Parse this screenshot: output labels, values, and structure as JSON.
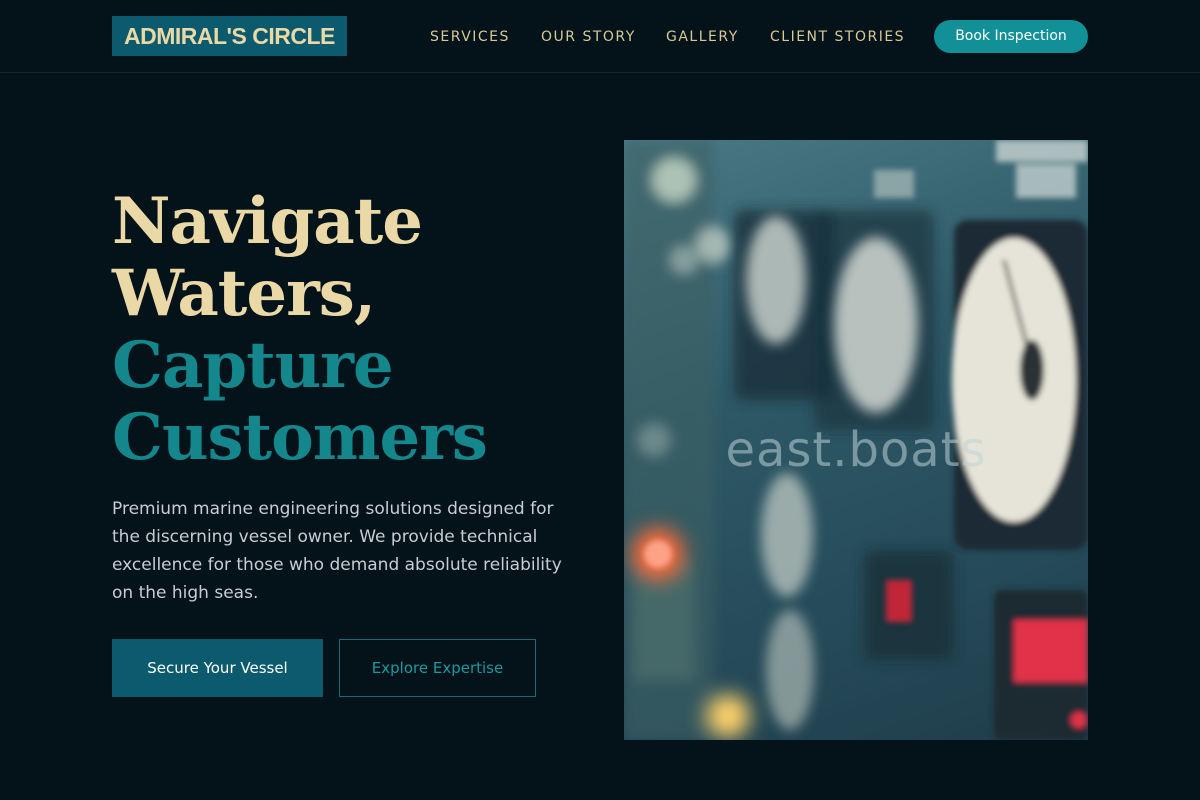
{
  "header": {
    "logo": "ADMIRAL'S CIRCLE",
    "nav": [
      "SERVICES",
      "OUR STORY",
      "GALLERY",
      "CLIENT STORIES"
    ],
    "cta": "Book Inspection"
  },
  "hero": {
    "headline_line1": "Navigate",
    "headline_line2": "Waters,",
    "headline_line3": "Capture",
    "headline_line4": "Customers",
    "description": "Premium marine engineering solutions designed for the discerning vessel owner. We provide technical excellence for those who demand absolute reliability on the high seas.",
    "primary_button": "Secure Your Vessel",
    "secondary_button": "Explore Expertise",
    "image_watermark": "east.boats"
  },
  "colors": {
    "background": "#04121a",
    "cream": "#ead9a6",
    "teal": "#13878c",
    "button_teal": "#129097",
    "logo_bg": "#0c5a6e"
  }
}
